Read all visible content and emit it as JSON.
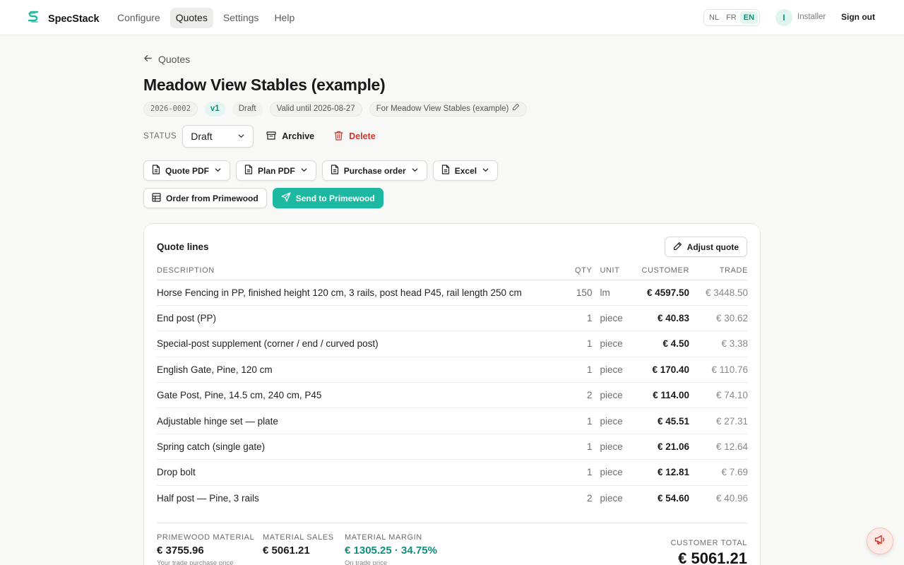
{
  "app": {
    "name": "SpecStack"
  },
  "nav": {
    "items": [
      {
        "label": "Configure"
      },
      {
        "label": "Quotes",
        "active": true
      },
      {
        "label": "Settings"
      },
      {
        "label": "Help"
      }
    ]
  },
  "lang": {
    "options": [
      "NL",
      "FR",
      "EN"
    ],
    "selected": "EN"
  },
  "user": {
    "initial": "I",
    "role": "Installer",
    "signout_label": "Sign out"
  },
  "back": {
    "label": "Quotes"
  },
  "quote": {
    "title": "Meadow View Stables (example)",
    "number": "2026-0002",
    "version": "v1",
    "state": "Draft",
    "valid_until": "Valid until 2026-08-27",
    "for": "For Meadow View Stables (example)"
  },
  "status": {
    "label": "STATUS",
    "value": "Draft",
    "archive_label": "Archive",
    "delete_label": "Delete"
  },
  "exports": {
    "quote_pdf": "Quote PDF",
    "plan_pdf": "Plan PDF",
    "purchase_order": "Purchase order",
    "excel": "Excel",
    "order_from": "Order from Primewood",
    "send_to": "Send to Primewood"
  },
  "lines": {
    "title": "Quote lines",
    "adjust_label": "Adjust quote",
    "headers": {
      "description": "DESCRIPTION",
      "qty": "QTY",
      "unit": "UNIT",
      "customer": "CUSTOMER",
      "trade": "TRADE"
    },
    "rows": [
      {
        "description": "Horse Fencing in PP, finished height 120 cm, 3 rails, post head P45, rail length 250 cm",
        "qty": "150",
        "unit": "lm",
        "customer": "€ 4597.50",
        "trade": "€ 3448.50"
      },
      {
        "description": "End post (PP)",
        "qty": "1",
        "unit": "piece",
        "customer": "€ 40.83",
        "trade": "€ 30.62"
      },
      {
        "description": "Special-post supplement (corner / end / curved post)",
        "qty": "1",
        "unit": "piece",
        "customer": "€ 4.50",
        "trade": "€ 3.38"
      },
      {
        "description": "English Gate, Pine, 120 cm",
        "qty": "1",
        "unit": "piece",
        "customer": "€ 170.40",
        "trade": "€ 110.76"
      },
      {
        "description": "Gate Post, Pine, 14.5 cm, 240 cm, P45",
        "qty": "2",
        "unit": "piece",
        "customer": "€ 114.00",
        "trade": "€ 74.10"
      },
      {
        "description": "Adjustable hinge set — plate",
        "qty": "1",
        "unit": "piece",
        "customer": "€ 45.51",
        "trade": "€ 27.31"
      },
      {
        "description": "Spring catch (single gate)",
        "qty": "1",
        "unit": "piece",
        "customer": "€ 21.06",
        "trade": "€ 12.64"
      },
      {
        "description": "Drop bolt",
        "qty": "1",
        "unit": "piece",
        "customer": "€ 12.81",
        "trade": "€ 7.69"
      },
      {
        "description": "Half post — Pine, 3 rails",
        "qty": "2",
        "unit": "piece",
        "customer": "€ 54.60",
        "trade": "€ 40.96"
      }
    ]
  },
  "summary": {
    "material": {
      "label": "PRIMEWOOD MATERIAL",
      "value": "€ 3755.96",
      "sub": "Your trade purchase price"
    },
    "sales": {
      "label": "MATERIAL SALES",
      "value": "€ 5061.21"
    },
    "margin": {
      "label": "MATERIAL MARGIN",
      "value": "€ 1305.25 · 34.75%",
      "sub": "On trade price"
    },
    "total": {
      "label": "CUSTOMER TOTAL",
      "value": "€ 5061.21"
    }
  },
  "colors": {
    "accent": "#1db8a0",
    "accent_text": "#0f8f7b",
    "danger": "#d0342c"
  },
  "icons": [
    "logo-icon",
    "arrow-left-icon",
    "archive-icon",
    "trash-icon",
    "document-icon",
    "chevron-down-icon",
    "grid-icon",
    "send-icon",
    "pencil-icon",
    "megaphone-icon"
  ]
}
